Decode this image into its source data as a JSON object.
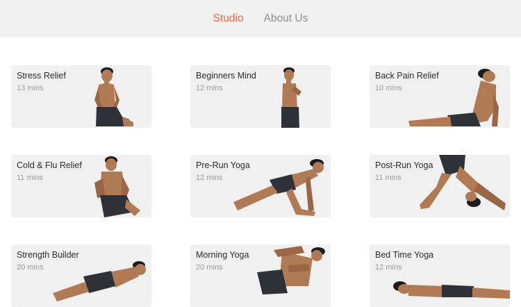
{
  "nav": {
    "tabs": [
      {
        "label": "Studio",
        "active": true
      },
      {
        "label": "About Us",
        "active": false
      }
    ]
  },
  "sessions": [
    {
      "title": "Stress Relief",
      "duration": "13 mins",
      "pose": "seated-kneeling"
    },
    {
      "title": "Beginners Mind",
      "duration": "12 mins",
      "pose": "standing-prayer"
    },
    {
      "title": "Back Pain Relief",
      "duration": "10 mins",
      "pose": "cobra"
    },
    {
      "title": "Cold & Flu Relief",
      "duration": "11 mins",
      "pose": "seated-twist"
    },
    {
      "title": "Pre-Run Yoga",
      "duration": "12 mins",
      "pose": "lunge"
    },
    {
      "title": "Post-Run Yoga",
      "duration": "11 mins",
      "pose": "downward-dog"
    },
    {
      "title": "Strength Builder",
      "duration": "20 mins",
      "pose": "plank"
    },
    {
      "title": "Morning Yoga",
      "duration": "20 mins",
      "pose": "twisted-squat"
    },
    {
      "title": "Bed Time Yoga",
      "duration": "12 mins",
      "pose": "lying-down"
    }
  ],
  "colors": {
    "accent": "#ec6a3f",
    "inactive_tab": "#8f8f8f",
    "card_bg": "#f0f0f0",
    "topbar_bg": "#f1f1f1"
  }
}
